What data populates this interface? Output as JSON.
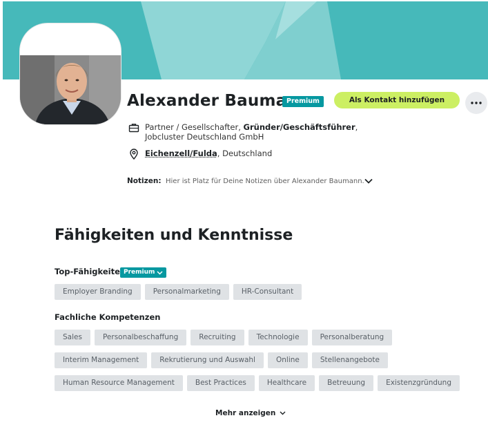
{
  "profile": {
    "name": "Alexander Baumann",
    "premium_badge": "Premium",
    "add_contact_label": "Als Kontakt hinzufügen",
    "job": {
      "prefix": "Partner / Gesellschafter, ",
      "bold": "Gründer/Geschäftsführer",
      "suffix": ", Jobcluster Deutschland GmbH"
    },
    "location": {
      "city": "Eichenzell/Fulda",
      "suffix": ", Deutschland"
    },
    "notes": {
      "label": "Notizen:",
      "text": "Hier ist Platz für Deine Notizen über Alexander Baumann."
    }
  },
  "skills": {
    "title": "Fähigkeiten und Kenntnisse",
    "top_label": "Top-Fähigkeiten",
    "top_premium": "Premium",
    "top_tags": [
      "Employer Branding",
      "Personalmarketing",
      "HR-Consultant"
    ],
    "fach_label": "Fachliche Kompetenzen",
    "row1": [
      "Sales",
      "Personalbeschaffung",
      "Recruiting",
      "Technologie",
      "Personalberatung"
    ],
    "row2": [
      "Interim Management",
      "Rekrutierung und Auswahl",
      "Online",
      "Stellenangebote"
    ],
    "row3": [
      "Human Resource Management",
      "Best Practices",
      "Healthcare",
      "Betreuung",
      "Existenzgründung"
    ],
    "show_more": "Mehr anzeigen"
  },
  "colors": {
    "banner": "#46b9ba",
    "accent_green": "#ccef63",
    "premium": "#0698a0",
    "tag_bg": "#dfe2e5"
  },
  "icons": {
    "job": "briefcase-icon",
    "location": "location-pin-icon",
    "more": "more-dots-icon",
    "notes_toggle": "chevron-down-icon"
  }
}
